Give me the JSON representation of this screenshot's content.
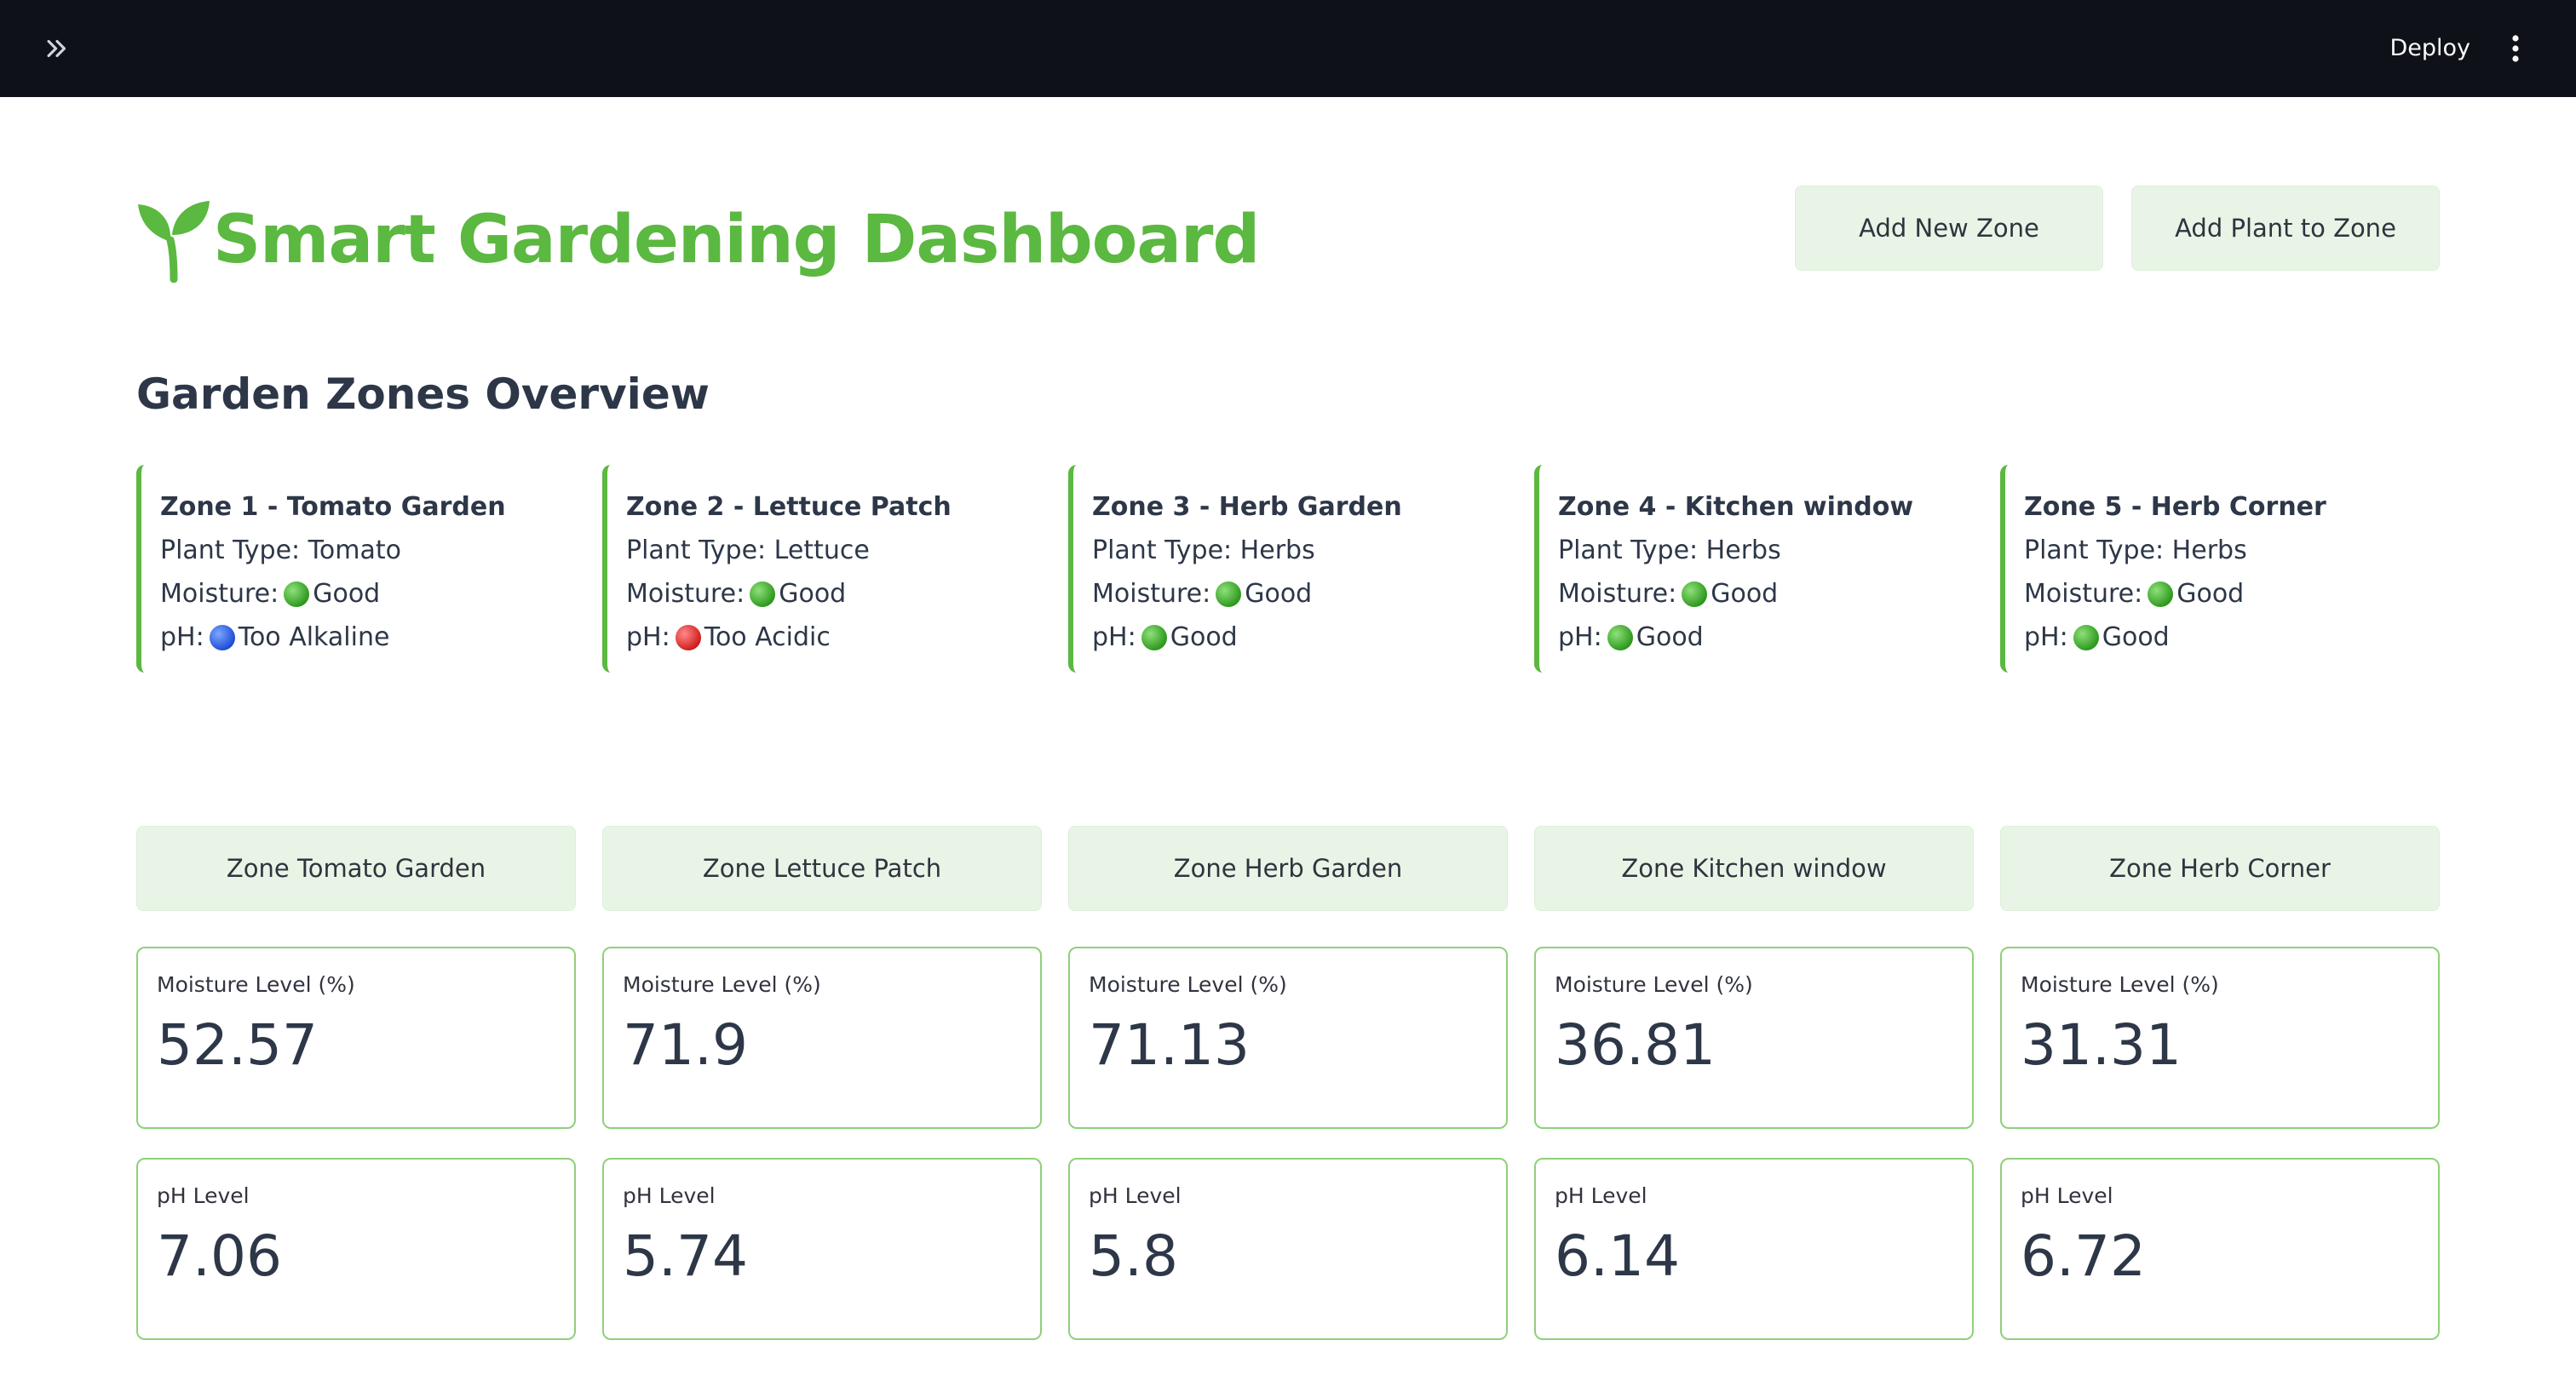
{
  "header": {
    "deploy_label": "Deploy"
  },
  "page": {
    "title": "Smart Gardening Dashboard",
    "section_title": "Garden Zones Overview"
  },
  "actions": {
    "add_zone": "Add New Zone",
    "add_plant": "Add Plant to Zone"
  },
  "colors": {
    "accent": "#5bb840",
    "button_bg": "#e8f5e6",
    "topbar": "#0e1117",
    "metric_border": "#8fd07a"
  },
  "zones": [
    {
      "title": "Zone 1 - Tomato Garden",
      "plant_type": "Plant Type: Tomato",
      "moisture_prefix": "Moisture:",
      "moisture_status": "Good",
      "ph_prefix": "pH:",
      "ph_status": "Too Alkaline",
      "button": "Zone Tomato Garden",
      "moisture_label": "Moisture Level (%)",
      "moisture_value": "52.57",
      "ph_label": "pH Level",
      "ph_value": "7.06"
    },
    {
      "title": "Zone 2 - Lettuce Patch",
      "plant_type": "Plant Type: Lettuce",
      "moisture_prefix": "Moisture:",
      "moisture_status": "Good",
      "ph_prefix": "pH:",
      "ph_status": "Too Acidic",
      "button": "Zone Lettuce Patch",
      "moisture_label": "Moisture Level (%)",
      "moisture_value": "71.9",
      "ph_label": "pH Level",
      "ph_value": "5.74"
    },
    {
      "title": "Zone 3 - Herb Garden",
      "plant_type": "Plant Type: Herbs",
      "moisture_prefix": "Moisture:",
      "moisture_status": "Good",
      "ph_prefix": "pH:",
      "ph_status": "Good",
      "button": "Zone Herb Garden",
      "moisture_label": "Moisture Level (%)",
      "moisture_value": "71.13",
      "ph_label": "pH Level",
      "ph_value": "5.8"
    },
    {
      "title": "Zone 4 - Kitchen window",
      "plant_type": "Plant Type: Herbs",
      "moisture_prefix": "Moisture:",
      "moisture_status": "Good",
      "ph_prefix": "pH:",
      "ph_status": "Good",
      "button": "Zone Kitchen window",
      "moisture_label": "Moisture Level (%)",
      "moisture_value": "36.81",
      "ph_label": "pH Level",
      "ph_value": "6.14"
    },
    {
      "title": "Zone 5 - Herb Corner",
      "plant_type": "Plant Type: Herbs",
      "moisture_prefix": "Moisture:",
      "moisture_status": "Good",
      "ph_prefix": "pH:",
      "ph_status": "Good",
      "button": "Zone Herb Corner",
      "moisture_label": "Moisture Level (%)",
      "moisture_value": "31.31",
      "ph_label": "pH Level",
      "ph_value": "6.72"
    }
  ]
}
